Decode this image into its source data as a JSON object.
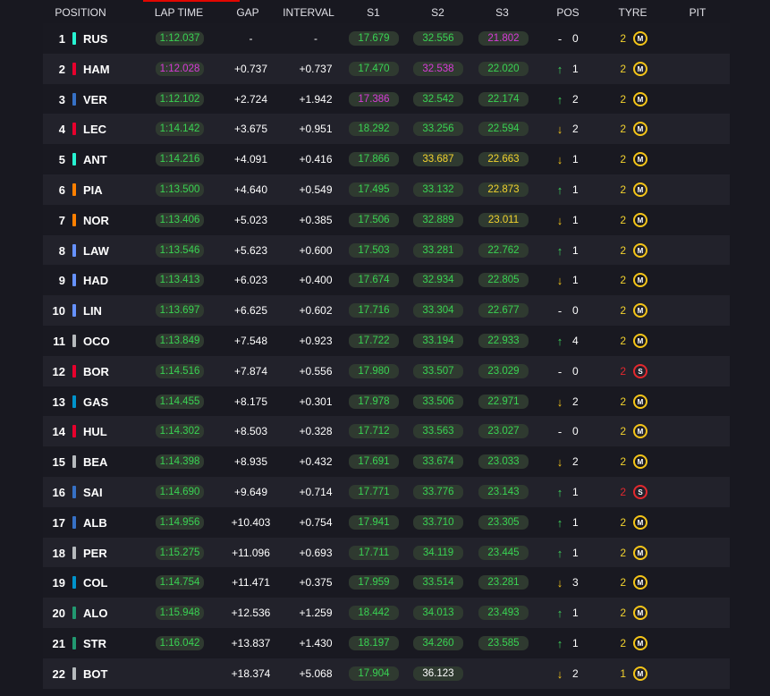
{
  "header": {
    "position": "POSITION",
    "lap_time": "LAP TIME",
    "gap": "GAP",
    "interval": "INTERVAL",
    "s1": "S1",
    "s2": "S2",
    "s3": "S3",
    "pos": "POS",
    "tyre": "TYRE",
    "pit": "PIT"
  },
  "colors": {
    "green": "#39d353",
    "purple": "#d83bd8",
    "yellow": "#f2d22e",
    "white": "#ffffff",
    "up": "#3fd35c",
    "down": "#f5c518",
    "medium": "#f5c518",
    "soft": "#e3282e",
    "pill_bg": "#2f3a30"
  },
  "rows": [
    {
      "pos": "1",
      "team_color": "#27f4d2",
      "driver": "RUS",
      "lap": "1:12.037",
      "lap_c": "green",
      "gap": "-",
      "interval": "-",
      "s1": "17.679",
      "s1_c": "green",
      "s2": "32.556",
      "s2_c": "green",
      "s3": "21.802",
      "s3_c": "purple",
      "dir": "none",
      "arrow": "-",
      "change": "0",
      "tyre_age": "2",
      "tyre_age_c": "yellow",
      "tyre": "M",
      "tyre_icon": "medium-tyre-icon"
    },
    {
      "pos": "2",
      "team_color": "#e8002d",
      "driver": "HAM",
      "lap": "1:12.028",
      "lap_c": "purple",
      "gap": "+0.737",
      "interval": "+0.737",
      "s1": "17.470",
      "s1_c": "green",
      "s2": "32.538",
      "s2_c": "purple",
      "s3": "22.020",
      "s3_c": "green",
      "dir": "up",
      "arrow": "↑",
      "change": "1",
      "tyre_age": "2",
      "tyre_age_c": "yellow",
      "tyre": "M",
      "tyre_icon": "medium-tyre-icon"
    },
    {
      "pos": "3",
      "team_color": "#3671c6",
      "driver": "VER",
      "lap": "1:12.102",
      "lap_c": "green",
      "gap": "+2.724",
      "interval": "+1.942",
      "s1": "17.386",
      "s1_c": "purple",
      "s2": "32.542",
      "s2_c": "green",
      "s3": "22.174",
      "s3_c": "green",
      "dir": "up",
      "arrow": "↑",
      "change": "2",
      "tyre_age": "2",
      "tyre_age_c": "yellow",
      "tyre": "M",
      "tyre_icon": "medium-tyre-icon"
    },
    {
      "pos": "4",
      "team_color": "#e8002d",
      "driver": "LEC",
      "lap": "1:14.142",
      "lap_c": "green",
      "gap": "+3.675",
      "interval": "+0.951",
      "s1": "18.292",
      "s1_c": "green",
      "s2": "33.256",
      "s2_c": "green",
      "s3": "22.594",
      "s3_c": "green",
      "dir": "down",
      "arrow": "↓",
      "change": "2",
      "tyre_age": "2",
      "tyre_age_c": "yellow",
      "tyre": "M",
      "tyre_icon": "medium-tyre-icon"
    },
    {
      "pos": "5",
      "team_color": "#27f4d2",
      "driver": "ANT",
      "lap": "1:14.216",
      "lap_c": "green",
      "gap": "+4.091",
      "interval": "+0.416",
      "s1": "17.866",
      "s1_c": "green",
      "s2": "33.687",
      "s2_c": "yellow",
      "s3": "22.663",
      "s3_c": "yellow",
      "dir": "down",
      "arrow": "↓",
      "change": "1",
      "tyre_age": "2",
      "tyre_age_c": "yellow",
      "tyre": "M",
      "tyre_icon": "medium-tyre-icon"
    },
    {
      "pos": "6",
      "team_color": "#ff8000",
      "driver": "PIA",
      "lap": "1:13.500",
      "lap_c": "green",
      "gap": "+4.640",
      "interval": "+0.549",
      "s1": "17.495",
      "s1_c": "green",
      "s2": "33.132",
      "s2_c": "green",
      "s3": "22.873",
      "s3_c": "yellow",
      "dir": "up",
      "arrow": "↑",
      "change": "1",
      "tyre_age": "2",
      "tyre_age_c": "yellow",
      "tyre": "M",
      "tyre_icon": "medium-tyre-icon"
    },
    {
      "pos": "7",
      "team_color": "#ff8000",
      "driver": "NOR",
      "lap": "1:13.406",
      "lap_c": "green",
      "gap": "+5.023",
      "interval": "+0.385",
      "s1": "17.506",
      "s1_c": "green",
      "s2": "32.889",
      "s2_c": "green",
      "s3": "23.011",
      "s3_c": "yellow",
      "dir": "down",
      "arrow": "↓",
      "change": "1",
      "tyre_age": "2",
      "tyre_age_c": "yellow",
      "tyre": "M",
      "tyre_icon": "medium-tyre-icon"
    },
    {
      "pos": "8",
      "team_color": "#6692ff",
      "driver": "LAW",
      "lap": "1:13.546",
      "lap_c": "green",
      "gap": "+5.623",
      "interval": "+0.600",
      "s1": "17.503",
      "s1_c": "green",
      "s2": "33.281",
      "s2_c": "green",
      "s3": "22.762",
      "s3_c": "green",
      "dir": "up",
      "arrow": "↑",
      "change": "1",
      "tyre_age": "2",
      "tyre_age_c": "yellow",
      "tyre": "M",
      "tyre_icon": "medium-tyre-icon"
    },
    {
      "pos": "9",
      "team_color": "#6692ff",
      "driver": "HAD",
      "lap": "1:13.413",
      "lap_c": "green",
      "gap": "+6.023",
      "interval": "+0.400",
      "s1": "17.674",
      "s1_c": "green",
      "s2": "32.934",
      "s2_c": "green",
      "s3": "22.805",
      "s3_c": "green",
      "dir": "down",
      "arrow": "↓",
      "change": "1",
      "tyre_age": "2",
      "tyre_age_c": "yellow",
      "tyre": "M",
      "tyre_icon": "medium-tyre-icon"
    },
    {
      "pos": "10",
      "team_color": "#6692ff",
      "driver": "LIN",
      "lap": "1:13.697",
      "lap_c": "green",
      "gap": "+6.625",
      "interval": "+0.602",
      "s1": "17.716",
      "s1_c": "green",
      "s2": "33.304",
      "s2_c": "green",
      "s3": "22.677",
      "s3_c": "green",
      "dir": "none",
      "arrow": "-",
      "change": "0",
      "tyre_age": "2",
      "tyre_age_c": "yellow",
      "tyre": "M",
      "tyre_icon": "medium-tyre-icon"
    },
    {
      "pos": "11",
      "team_color": "#b6babd",
      "driver": "OCO",
      "lap": "1:13.849",
      "lap_c": "green",
      "gap": "+7.548",
      "interval": "+0.923",
      "s1": "17.722",
      "s1_c": "green",
      "s2": "33.194",
      "s2_c": "green",
      "s3": "22.933",
      "s3_c": "green",
      "dir": "up",
      "arrow": "↑",
      "change": "4",
      "tyre_age": "2",
      "tyre_age_c": "yellow",
      "tyre": "M",
      "tyre_icon": "medium-tyre-icon"
    },
    {
      "pos": "12",
      "team_color": "#e8002d",
      "driver": "BOR",
      "lap": "1:14.516",
      "lap_c": "green",
      "gap": "+7.874",
      "interval": "+0.556",
      "s1": "17.980",
      "s1_c": "green",
      "s2": "33.507",
      "s2_c": "green",
      "s3": "23.029",
      "s3_c": "green",
      "dir": "none",
      "arrow": "-",
      "change": "0",
      "tyre_age": "2",
      "tyre_age_c": "soft",
      "tyre": "S",
      "tyre_icon": "soft-tyre-icon"
    },
    {
      "pos": "13",
      "team_color": "#0093cc",
      "driver": "GAS",
      "lap": "1:14.455",
      "lap_c": "green",
      "gap": "+8.175",
      "interval": "+0.301",
      "s1": "17.978",
      "s1_c": "green",
      "s2": "33.506",
      "s2_c": "green",
      "s3": "22.971",
      "s3_c": "green",
      "dir": "down",
      "arrow": "↓",
      "change": "2",
      "tyre_age": "2",
      "tyre_age_c": "yellow",
      "tyre": "M",
      "tyre_icon": "medium-tyre-icon"
    },
    {
      "pos": "14",
      "team_color": "#e8002d",
      "driver": "HUL",
      "lap": "1:14.302",
      "lap_c": "green",
      "gap": "+8.503",
      "interval": "+0.328",
      "s1": "17.712",
      "s1_c": "green",
      "s2": "33.563",
      "s2_c": "green",
      "s3": "23.027",
      "s3_c": "green",
      "dir": "none",
      "arrow": "-",
      "change": "0",
      "tyre_age": "2",
      "tyre_age_c": "yellow",
      "tyre": "M",
      "tyre_icon": "medium-tyre-icon"
    },
    {
      "pos": "15",
      "team_color": "#b6babd",
      "driver": "BEA",
      "lap": "1:14.398",
      "lap_c": "green",
      "gap": "+8.935",
      "interval": "+0.432",
      "s1": "17.691",
      "s1_c": "green",
      "s2": "33.674",
      "s2_c": "green",
      "s3": "23.033",
      "s3_c": "green",
      "dir": "down",
      "arrow": "↓",
      "change": "2",
      "tyre_age": "2",
      "tyre_age_c": "yellow",
      "tyre": "M",
      "tyre_icon": "medium-tyre-icon"
    },
    {
      "pos": "16",
      "team_color": "#3671c6",
      "driver": "SAI",
      "lap": "1:14.690",
      "lap_c": "green",
      "gap": "+9.649",
      "interval": "+0.714",
      "s1": "17.771",
      "s1_c": "green",
      "s2": "33.776",
      "s2_c": "green",
      "s3": "23.143",
      "s3_c": "green",
      "dir": "up",
      "arrow": "↑",
      "change": "1",
      "tyre_age": "2",
      "tyre_age_c": "soft",
      "tyre": "S",
      "tyre_icon": "soft-tyre-icon"
    },
    {
      "pos": "17",
      "team_color": "#3671c6",
      "driver": "ALB",
      "lap": "1:14.956",
      "lap_c": "green",
      "gap": "+10.403",
      "interval": "+0.754",
      "s1": "17.941",
      "s1_c": "green",
      "s2": "33.710",
      "s2_c": "green",
      "s3": "23.305",
      "s3_c": "green",
      "dir": "up",
      "arrow": "↑",
      "change": "1",
      "tyre_age": "2",
      "tyre_age_c": "yellow",
      "tyre": "M",
      "tyre_icon": "medium-tyre-icon"
    },
    {
      "pos": "18",
      "team_color": "#b6babd",
      "driver": "PER",
      "lap": "1:15.275",
      "lap_c": "green",
      "gap": "+11.096",
      "interval": "+0.693",
      "s1": "17.711",
      "s1_c": "green",
      "s2": "34.119",
      "s2_c": "green",
      "s3": "23.445",
      "s3_c": "green",
      "dir": "up",
      "arrow": "↑",
      "change": "1",
      "tyre_age": "2",
      "tyre_age_c": "yellow",
      "tyre": "M",
      "tyre_icon": "medium-tyre-icon"
    },
    {
      "pos": "19",
      "team_color": "#0093cc",
      "driver": "COL",
      "lap": "1:14.754",
      "lap_c": "green",
      "gap": "+11.471",
      "interval": "+0.375",
      "s1": "17.959",
      "s1_c": "green",
      "s2": "33.514",
      "s2_c": "green",
      "s3": "23.281",
      "s3_c": "green",
      "dir": "down",
      "arrow": "↓",
      "change": "3",
      "tyre_age": "2",
      "tyre_age_c": "yellow",
      "tyre": "M",
      "tyre_icon": "medium-tyre-icon"
    },
    {
      "pos": "20",
      "team_color": "#229971",
      "driver": "ALO",
      "lap": "1:15.948",
      "lap_c": "green",
      "gap": "+12.536",
      "interval": "+1.259",
      "s1": "18.442",
      "s1_c": "green",
      "s2": "34.013",
      "s2_c": "green",
      "s3": "23.493",
      "s3_c": "green",
      "dir": "up",
      "arrow": "↑",
      "change": "1",
      "tyre_age": "2",
      "tyre_age_c": "yellow",
      "tyre": "M",
      "tyre_icon": "medium-tyre-icon"
    },
    {
      "pos": "21",
      "team_color": "#229971",
      "driver": "STR",
      "lap": "1:16.042",
      "lap_c": "green",
      "gap": "+13.837",
      "interval": "+1.430",
      "s1": "18.197",
      "s1_c": "green",
      "s2": "34.260",
      "s2_c": "green",
      "s3": "23.585",
      "s3_c": "green",
      "dir": "up",
      "arrow": "↑",
      "change": "1",
      "tyre_age": "2",
      "tyre_age_c": "yellow",
      "tyre": "M",
      "tyre_icon": "medium-tyre-icon"
    },
    {
      "pos": "22",
      "team_color": "#b6babd",
      "driver": "BOT",
      "lap": "",
      "lap_c": "green",
      "gap": "+18.374",
      "interval": "+5.068",
      "s1": "17.904",
      "s1_c": "green",
      "s2": "36.123",
      "s2_c": "white",
      "s3": "",
      "s3_c": "green",
      "dir": "down",
      "arrow": "↓",
      "change": "2",
      "tyre_age": "1",
      "tyre_age_c": "yellow",
      "tyre": "M",
      "tyre_icon": "medium-tyre-icon"
    }
  ]
}
